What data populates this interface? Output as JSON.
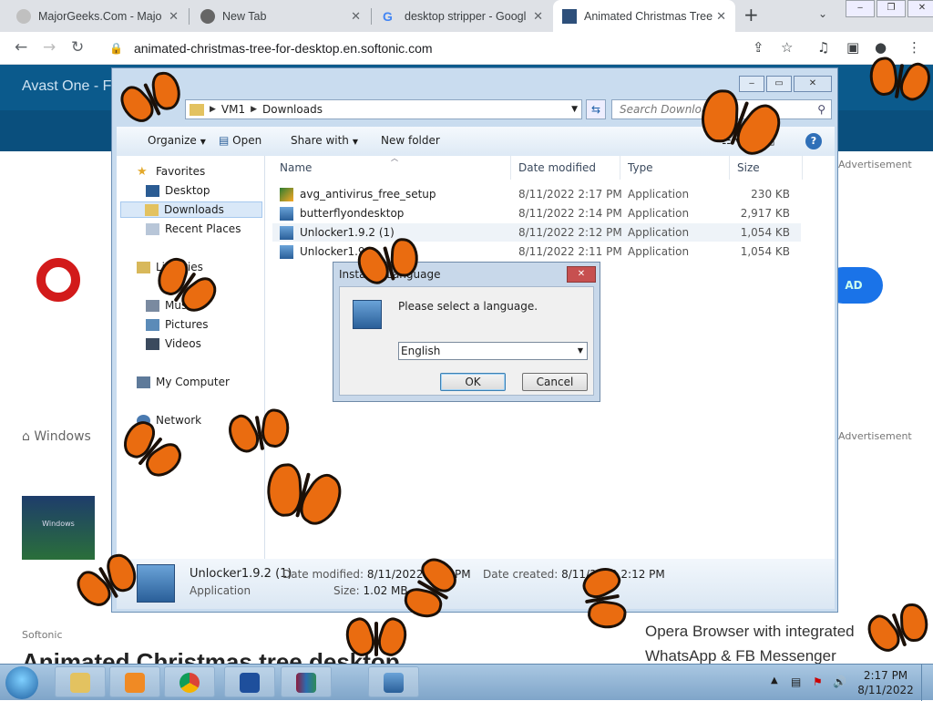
{
  "browser": {
    "tabs": [
      {
        "title": "MajorGeeks.Com - Majo",
        "active": false
      },
      {
        "title": "New Tab",
        "active": false
      },
      {
        "title": "desktop stripper - Googl",
        "active": false
      },
      {
        "title": "Animated Christmas Tree",
        "active": true
      }
    ],
    "url": "animated-christmas-tree-for-desktop.en.softonic.com",
    "icons": {
      "back": "back-arrow-icon",
      "forward": "forward-arrow-icon",
      "reload": "reload-icon",
      "lock": "lock-icon",
      "share": "share-icon",
      "bookmark": "star-icon",
      "media": "media-icon",
      "sidepanel": "side-panel-icon",
      "profile": "profile-icon",
      "menu": "kebab-menu-icon"
    }
  },
  "site": {
    "banner": "Avast One - Fr",
    "ad_label": "Advertisement",
    "crumb": "Windows",
    "opera_ad": "Opera Browser with integrated WhatsApp & FB Messenger",
    "title_fragment": "Animated Christmas tree desktop",
    "download_short": "AD",
    "softonic_label": "Softonic",
    "thumb_label": "Windows"
  },
  "explorer": {
    "path": [
      "VM1",
      "Downloads"
    ],
    "search_placeholder": "Search Downloads",
    "commands": {
      "organize": "Organize",
      "open": "Open",
      "share_with": "Share with",
      "new_folder": "New folder"
    },
    "nav": [
      {
        "label": "Favorites",
        "icon": "star-icon"
      },
      {
        "label": "Desktop",
        "icon": "desktop-icon"
      },
      {
        "label": "Downloads",
        "icon": "downloads-folder-icon",
        "selected": true
      },
      {
        "label": "Recent Places",
        "icon": "recent-places-icon"
      },
      {
        "label": "Libraries",
        "icon": "libraries-icon"
      },
      {
        "label": "Music",
        "icon": "music-icon"
      },
      {
        "label": "Pictures",
        "icon": "pictures-icon"
      },
      {
        "label": "Videos",
        "icon": "videos-icon"
      },
      {
        "label": "My Computer",
        "icon": "computer-icon"
      },
      {
        "label": "Network",
        "icon": "network-icon"
      }
    ],
    "columns": {
      "name": "Name",
      "date": "Date modified",
      "type": "Type",
      "size": "Size"
    },
    "files": [
      {
        "name": "avg_antivirus_free_setup",
        "date": "8/11/2022 2:17 PM",
        "type": "Application",
        "size": "230 KB"
      },
      {
        "name": "butterflyondesktop",
        "date": "8/11/2022 2:14 PM",
        "type": "Application",
        "size": "2,917 KB"
      },
      {
        "name": "Unlocker1.9.2 (1)",
        "date": "8/11/2022 2:12 PM",
        "type": "Application",
        "size": "1,054 KB",
        "highlighted": true
      },
      {
        "name": "Unlocker1.9.2",
        "date": "8/11/2022 2:11 PM",
        "type": "Application",
        "size": "1,054 KB"
      }
    ],
    "details": {
      "name": "Unlocker1.9.2 (1)",
      "type": "Application",
      "modified_label": "Date modified:",
      "modified": "8/11/2022 2:12 PM",
      "created_label": "Date created:",
      "created": "8/11/2022 2:12 PM",
      "size_label": "Size:",
      "size": "1.02 MB"
    }
  },
  "dialog": {
    "title": "Installer Language",
    "message": "Please select a language.",
    "selected": "English",
    "ok": "OK",
    "cancel": "Cancel"
  },
  "taskbar": {
    "apps": [
      "file-explorer-icon",
      "media-player-icon",
      "chrome-icon",
      "powershell-icon",
      "winrar-icon",
      "installer-icon"
    ],
    "time": "2:17 PM",
    "date": "8/11/2022"
  },
  "colors": {
    "accent": "#1a73e8",
    "butterfly": "#ea6c10",
    "site_header": "#0b5a8c"
  }
}
